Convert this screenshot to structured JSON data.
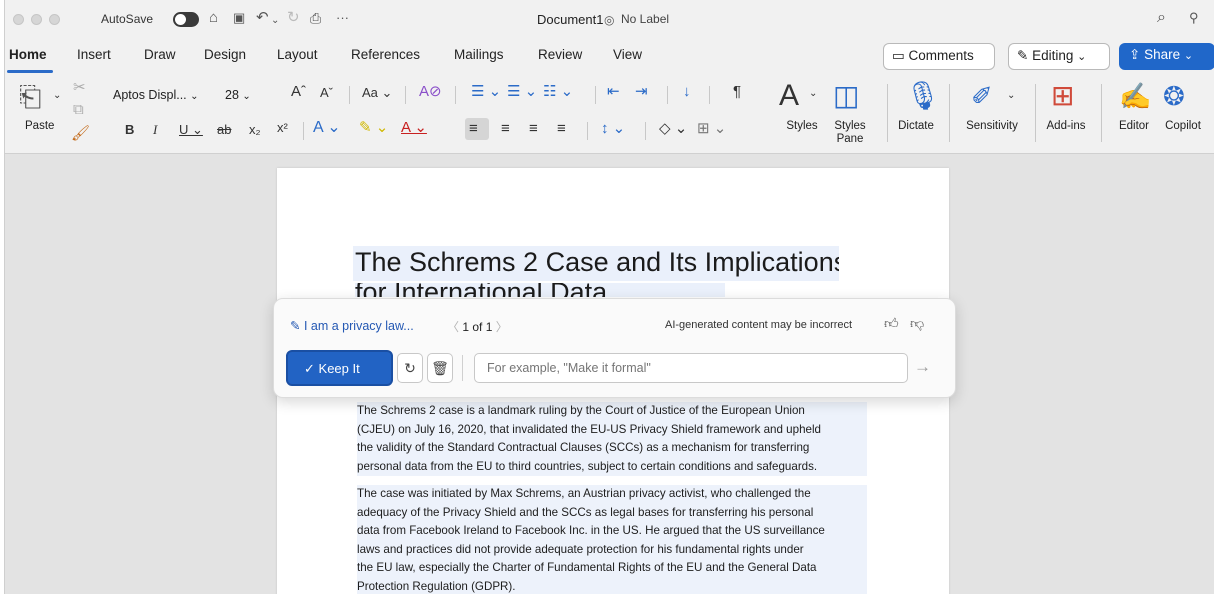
{
  "titlebar": {
    "autosave_label": "AutoSave",
    "doc_title": "Document1",
    "label_status": "No Label"
  },
  "tabs": [
    "Home",
    "Insert",
    "Draw",
    "Design",
    "Layout",
    "References",
    "Mailings",
    "Review",
    "View"
  ],
  "tab_actions": {
    "comments": "Comments",
    "editing": "Editing",
    "share": "Share"
  },
  "ribbon": {
    "paste": "Paste",
    "font_name": "Aptos Displ...",
    "font_size": "28",
    "styles": "Styles",
    "styles_pane_1": "Styles",
    "styles_pane_2": "Pane",
    "dictate": "Dictate",
    "sensitivity": "Sensitivity",
    "addins": "Add-ins",
    "editor": "Editor",
    "copilot": "Copilot"
  },
  "document": {
    "heading": "The Schrems 2 Case and Its Implications",
    "heading_line2": "for International Data Transfers",
    "para1": [
      "The Schrems 2 case is a landmark ruling by the Court of Justice of the European Union",
      "(CJEU) on July 16, 2020, that invalidated the EU-US Privacy Shield framework and upheld",
      "the validity of the Standard Contractual Clauses (SCCs) as a mechanism for transferring",
      "personal data from the EU to third countries, subject to certain conditions and safeguards."
    ],
    "para2": [
      "The case was initiated by Max Schrems, an Austrian privacy activist, who challenged the",
      "adequacy of the Privacy Shield and the SCCs as legal bases for transferring his personal",
      "data from Facebook Ireland to Facebook Inc. in the US. He argued that the US surveillance",
      "laws and practices did not provide adequate protection for his fundamental rights under",
      "the EU law, especially the Charter of Fundamental Rights of the EU and the General Data",
      "Protection Regulation (GDPR)."
    ]
  },
  "copilot_popup": {
    "prompt_label": "I am a privacy law...",
    "pager": "1 of 1",
    "ai_note": "AI-generated content may be incorrect",
    "keep_label": "Keep It",
    "refine_placeholder": "For example, \"Make it formal\""
  },
  "icons": {
    "undo": "undo-icon",
    "redo": "redo-icon",
    "search": "search-icon",
    "thumbs_up": "thumbs-up-icon",
    "thumbs_down": "thumbs-down-icon",
    "regenerate": "regenerate-icon",
    "discard": "trash-icon",
    "send": "send-arrow-icon"
  },
  "colors": {
    "accent": "#2067c9",
    "selection": "#eaf0fb",
    "spelling": "#d04040"
  }
}
